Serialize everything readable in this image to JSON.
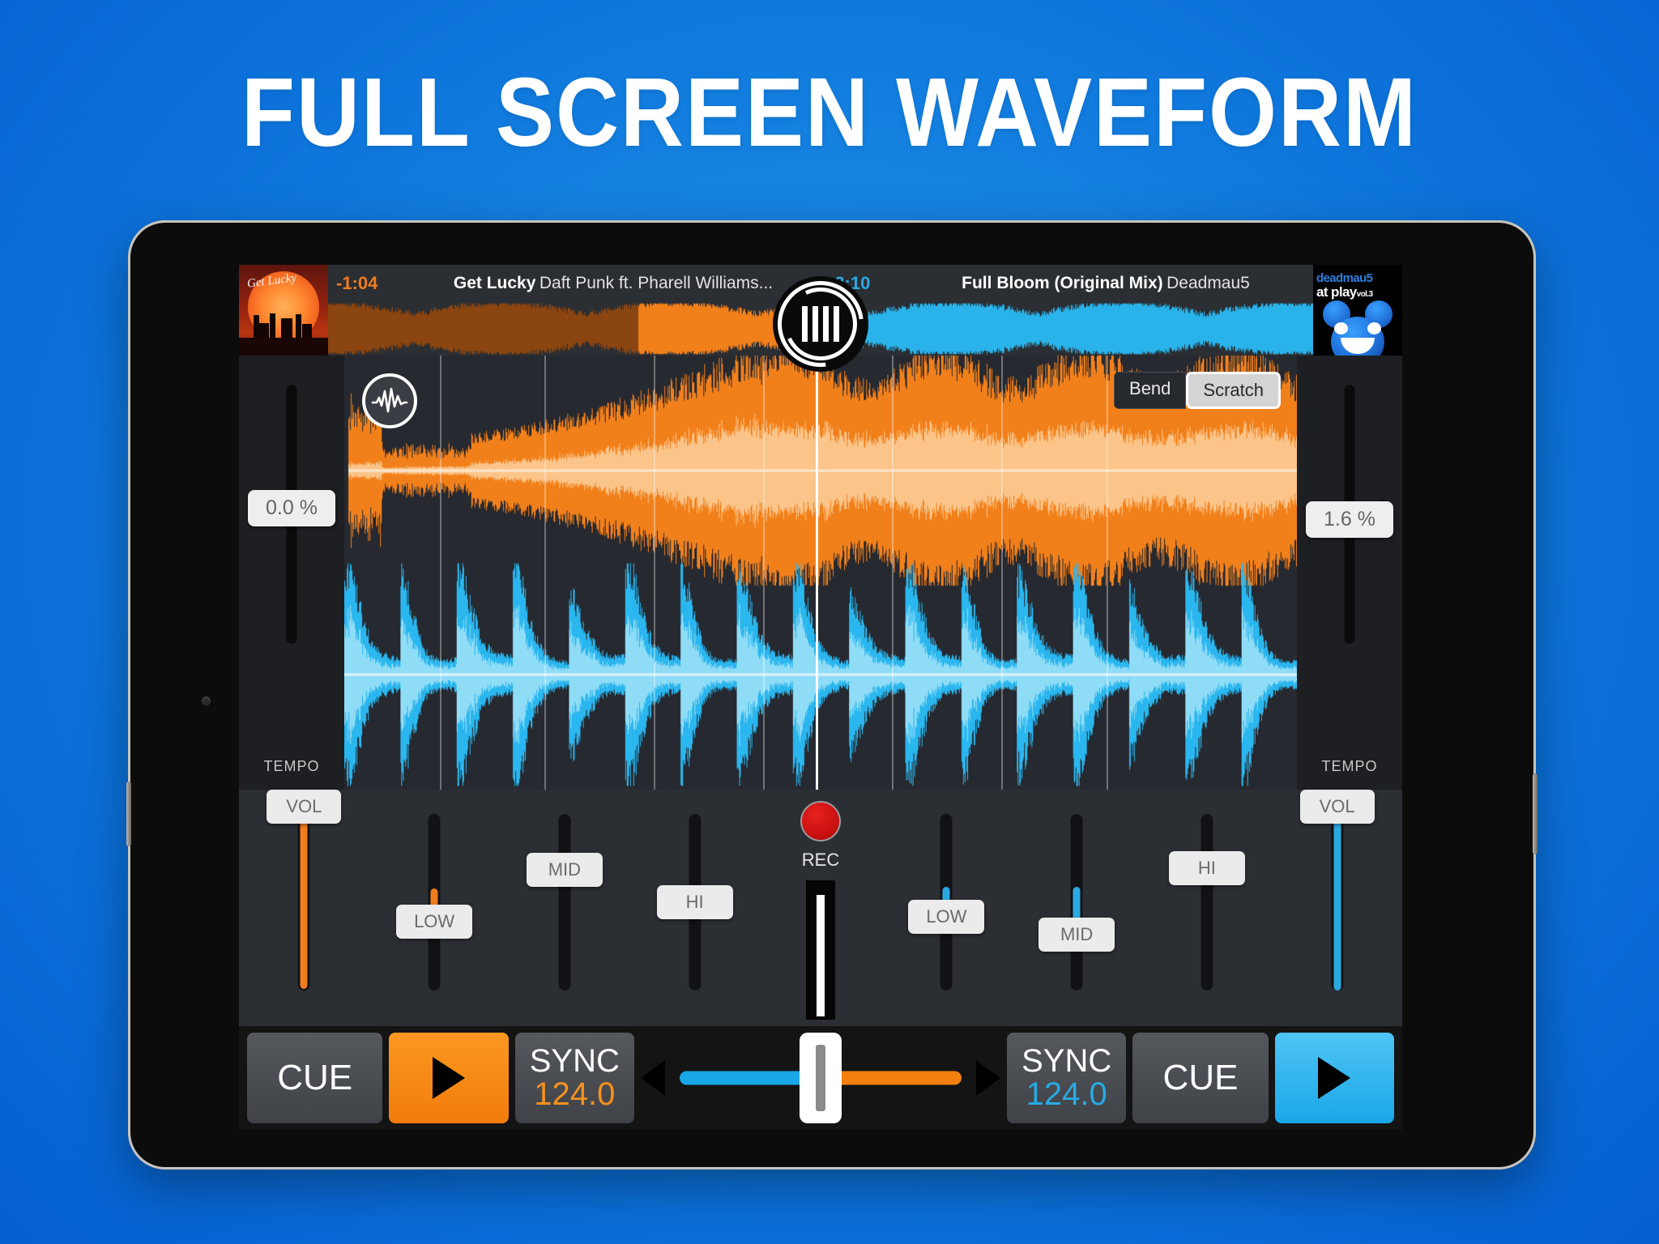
{
  "headline": "FULL SCREEN WAVEFORM",
  "colors": {
    "background_blue": "#1480e0",
    "deck_a_accent": "#f07c1e",
    "deck_b_accent": "#2aa9e0",
    "rec_red": "#c40f0f",
    "panel_dark": "#2b2e33",
    "wave_bg": "#262930"
  },
  "deck_a": {
    "remaining_time": "-1:04",
    "track_title": "Get Lucky",
    "track_artist": "Daft Punk ft. Pharell Williams...",
    "album_art_title": "Get Lucky",
    "tempo_value": "0.0 %",
    "tempo_label": "TEMPO",
    "faders": [
      {
        "label": "VOL",
        "name": "vol"
      },
      {
        "label": "LOW",
        "name": "low"
      },
      {
        "label": "MID",
        "name": "mid"
      },
      {
        "label": "HI",
        "name": "hi"
      }
    ],
    "cue_label": "CUE",
    "play_label": "play-icon",
    "sync_label": "SYNC",
    "sync_bpm": "124.0"
  },
  "deck_b": {
    "remaining_time": "-3:10",
    "track_title": "Full Bloom (Original Mix)",
    "track_artist": "Deadmau5",
    "album_art_line1": "deadmau5",
    "album_art_line2": "at play",
    "album_art_line2_sub": "vol.3",
    "tempo_value": "1.6 %",
    "tempo_label": "TEMPO",
    "faders": [
      {
        "label": "LOW",
        "name": "low"
      },
      {
        "label": "MID",
        "name": "mid"
      },
      {
        "label": "HI",
        "name": "hi"
      },
      {
        "label": "VOL",
        "name": "vol"
      }
    ],
    "cue_label": "CUE",
    "play_label": "play-icon",
    "sync_label": "SYNC",
    "sync_bpm": "124.0"
  },
  "center": {
    "jog_icon": "pause-bars-icon",
    "rec_label": "REC",
    "crossfader_left_arrow": "triangle-left-icon",
    "crossfader_right_arrow": "triangle-right-icon"
  },
  "waveform_controls": {
    "fx_icon": "waveform-pulse-icon",
    "mode_options": [
      {
        "label": "Bend",
        "selected": false
      },
      {
        "label": "Scratch",
        "selected": true
      }
    ]
  }
}
